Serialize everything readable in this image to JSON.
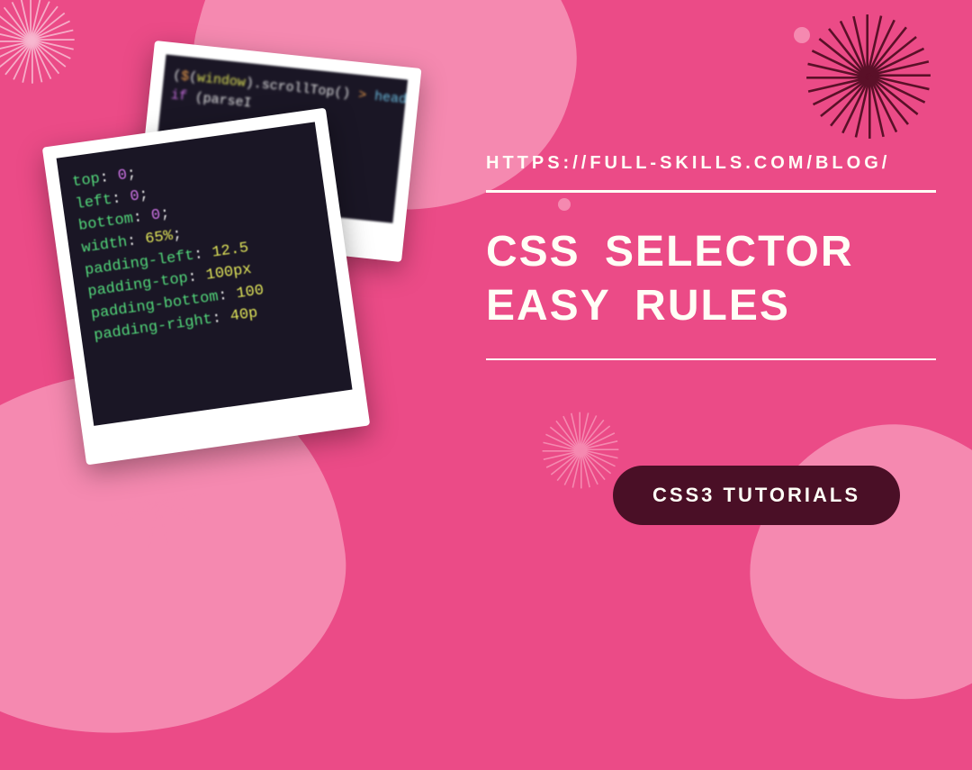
{
  "url_text": "https://full-skills.com/blog/",
  "title": "CSS Selector Easy Rules",
  "badge": "CSS3 Tutorials",
  "code_front": [
    {
      "prop": "top",
      "val": "0",
      "unit": ";"
    },
    {
      "prop": "left",
      "val": "0",
      "unit": ";"
    },
    {
      "prop": "bottom",
      "val": "0",
      "unit": ";"
    },
    {
      "prop": "width",
      "val": "65%",
      "unit": ";"
    },
    {
      "prop": "padding-left",
      "val": "12.5",
      "unit": ""
    },
    {
      "prop": "padding-top",
      "val": "100px",
      "unit": ""
    },
    {
      "prop": "padding-bottom",
      "val": "100",
      "unit": ""
    },
    {
      "prop": "padding-right",
      "val": "40p",
      "unit": ""
    }
  ],
  "code_back_line1": "($(window).scrollTop()",
  "code_back_line2": "if (parseI"
}
